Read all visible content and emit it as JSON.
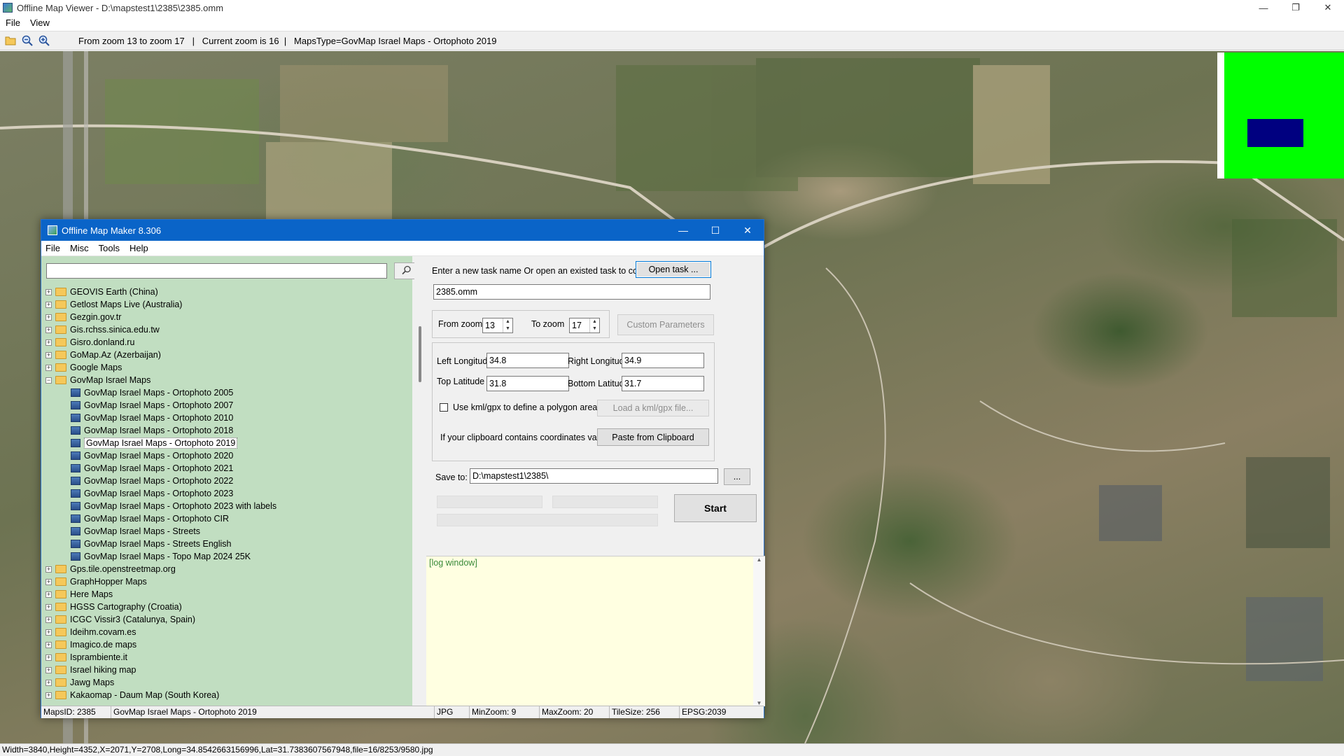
{
  "viewer": {
    "title": "Offline Map Viewer - D:\\mapstest1\\2385\\2385.omm",
    "menu": [
      "File",
      "View"
    ],
    "toolbar_info": "From zoom 13 to zoom 17   |   Current zoom is 16  |   MapsType=GovMap Israel Maps - Ortophoto 2019",
    "status": "Width=3840,Height=4352,X=2071,Y=2708,Long=34.8542663156996,Lat=31.7383607567948,file=16/8253/9580.jpg",
    "icons": {
      "open": "folder-open-icon",
      "zoom_out": "zoom-out-icon",
      "zoom_in": "zoom-in-icon"
    },
    "window_controls": {
      "minimize": "—",
      "restore": "❐",
      "close": "✕"
    }
  },
  "dialog": {
    "title": "Offline Map Maker 8.306",
    "menu": [
      "File",
      "Misc",
      "Tools",
      "Help"
    ],
    "window_controls": {
      "minimize": "—",
      "maximize": "☐",
      "close": "✕"
    },
    "search": {
      "value": "",
      "button_icon": "search-icon"
    },
    "tree": [
      {
        "label": "GEOVIS Earth (China)",
        "type": "folder",
        "expanded": false
      },
      {
        "label": "Getlost Maps Live (Australia)",
        "type": "folder",
        "expanded": false
      },
      {
        "label": "Gezgin.gov.tr",
        "type": "folder",
        "expanded": false
      },
      {
        "label": "Gis.rchss.sinica.edu.tw",
        "type": "folder",
        "expanded": false
      },
      {
        "label": "Gisro.donland.ru",
        "type": "folder",
        "expanded": false
      },
      {
        "label": "GoMap.Az (Azerbaijan)",
        "type": "folder",
        "expanded": false
      },
      {
        "label": "Google Maps",
        "type": "folder",
        "expanded": false
      },
      {
        "label": "GovMap Israel Maps",
        "type": "folder",
        "expanded": true
      },
      {
        "label": "GovMap Israel Maps - Ortophoto 2005",
        "type": "map"
      },
      {
        "label": "GovMap Israel Maps - Ortophoto 2007",
        "type": "map"
      },
      {
        "label": "GovMap Israel Maps - Ortophoto 2010",
        "type": "map"
      },
      {
        "label": "GovMap Israel Maps - Ortophoto 2018",
        "type": "map"
      },
      {
        "label": "GovMap Israel Maps - Ortophoto 2019",
        "type": "map",
        "selected": true
      },
      {
        "label": "GovMap Israel Maps - Ortophoto 2020",
        "type": "map"
      },
      {
        "label": "GovMap Israel Maps - Ortophoto 2021",
        "type": "map"
      },
      {
        "label": "GovMap Israel Maps - Ortophoto 2022",
        "type": "map"
      },
      {
        "label": "GovMap Israel Maps - Ortophoto 2023",
        "type": "map"
      },
      {
        "label": "GovMap Israel Maps - Ortophoto 2023 with labels",
        "type": "map"
      },
      {
        "label": "GovMap Israel Maps - Ortophoto CIR",
        "type": "map"
      },
      {
        "label": "GovMap Israel Maps - Streets",
        "type": "map"
      },
      {
        "label": "GovMap Israel Maps - Streets English",
        "type": "map"
      },
      {
        "label": "GovMap Israel Maps - Topo Map 2024 25K",
        "type": "map"
      },
      {
        "label": "Gps.tile.openstreetmap.org",
        "type": "folder",
        "expanded": false
      },
      {
        "label": "GraphHopper Maps",
        "type": "folder",
        "expanded": false
      },
      {
        "label": "Here Maps",
        "type": "folder",
        "expanded": false
      },
      {
        "label": "HGSS Cartography (Croatia)",
        "type": "folder",
        "expanded": false
      },
      {
        "label": "ICGC Vissir3 (Catalunya, Spain)",
        "type": "folder",
        "expanded": false
      },
      {
        "label": "Ideihm.covam.es",
        "type": "folder",
        "expanded": false
      },
      {
        "label": "Imagico.de maps",
        "type": "folder",
        "expanded": false
      },
      {
        "label": "Isprambiente.it",
        "type": "folder",
        "expanded": false
      },
      {
        "label": "Israel hiking map",
        "type": "folder",
        "expanded": false
      },
      {
        "label": "Jawg Maps",
        "type": "folder",
        "expanded": false
      },
      {
        "label": "Kakaomap - Daum Map (South Korea)",
        "type": "folder",
        "expanded": false
      }
    ],
    "task_prompt": "Enter a new task name Or open an existed task to continue:",
    "open_task_label": "Open task ...",
    "task_name": "2385.omm",
    "from_zoom_label": "From zoom",
    "from_zoom_value": "13",
    "to_zoom_label": "To zoom",
    "to_zoom_value": "17",
    "custom_params_label": "Custom Parameters",
    "left_lon_label": "Left Longitude",
    "left_lon_value": "34.8",
    "right_lon_label": "Right Longitude",
    "right_lon_value": "34.9",
    "top_lat_label": "Top Latitude",
    "top_lat_value": "31.8",
    "bottom_lat_label": "Bottom Latitude",
    "bottom_lat_value": "31.7",
    "kml_checkbox_label": "Use kml/gpx to define a polygon area",
    "load_kml_label": "Load a kml/gpx file...",
    "clipboard_prompt": "If your clipboard contains coordinates values:",
    "paste_label": "Paste from Clipboard",
    "save_to_label": "Save to:",
    "save_to_value": "D:\\mapstest1\\2385\\",
    "browse_label": "...",
    "start_label": "Start",
    "log_label": "[log window]",
    "status": {
      "maps_id": "MapsID: 2385",
      "name": "GovMap Israel Maps - Ortophoto 2019",
      "format": "JPG",
      "min_zoom": "MinZoom: 9",
      "max_zoom": "MaxZoom: 20",
      "tile_size": "TileSize: 256",
      "epsg": "EPSG:2039"
    }
  },
  "colors": {
    "dialog_title_bg": "#0a64c8",
    "tree_bg": "#c1dec1",
    "log_bg": "#ffffe1",
    "log_text": "#3a8a3a",
    "minimap_green": "#00ff00",
    "minimap_blue": "#000080"
  }
}
